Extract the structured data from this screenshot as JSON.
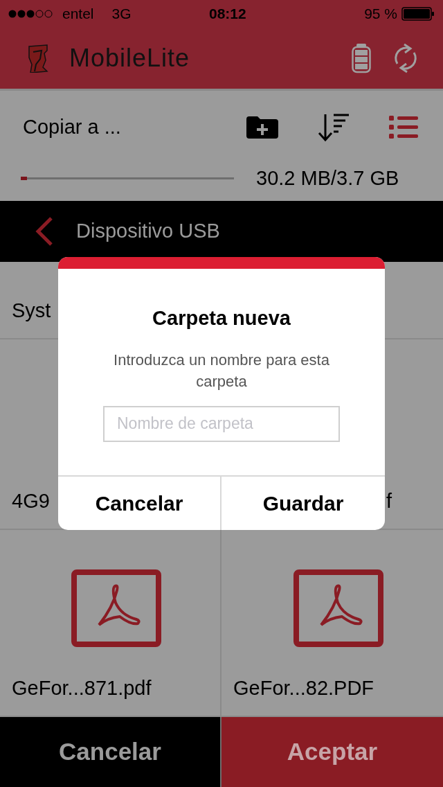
{
  "status_bar": {
    "carrier": "entel",
    "network": "3G",
    "time": "08:12",
    "battery": "95 %"
  },
  "header": {
    "app_name": "MobileLite"
  },
  "toolbar": {
    "title": "Copiar a ...",
    "storage": {
      "level": 0.03,
      "reading": "30.2 MB/3.7 GB"
    }
  },
  "location": {
    "title": "Dispositivo USB"
  },
  "file_rows": [
    {
      "cells": [
        {
          "name": "Syst",
          "kind": "covered"
        }
      ]
    },
    {
      "cells": [
        {
          "name": "4G9",
          "kind": "covered"
        },
        {
          "name": "f",
          "kind": "covered"
        }
      ]
    },
    {
      "cells": [
        {
          "name": "GeFor...871.pdf",
          "kind": "pdf"
        },
        {
          "name": "GeFor...82.PDF",
          "kind": "pdf"
        }
      ]
    }
  ],
  "dialog": {
    "title": "Carpeta nueva",
    "message": "Introduzca un nombre para esta carpeta",
    "placeholder": "Nombre de carpeta",
    "buttons": [
      "Cancelar",
      "Guardar"
    ]
  },
  "bottom_bar": {
    "buttons": [
      "Cancelar",
      "Aceptar"
    ]
  }
}
